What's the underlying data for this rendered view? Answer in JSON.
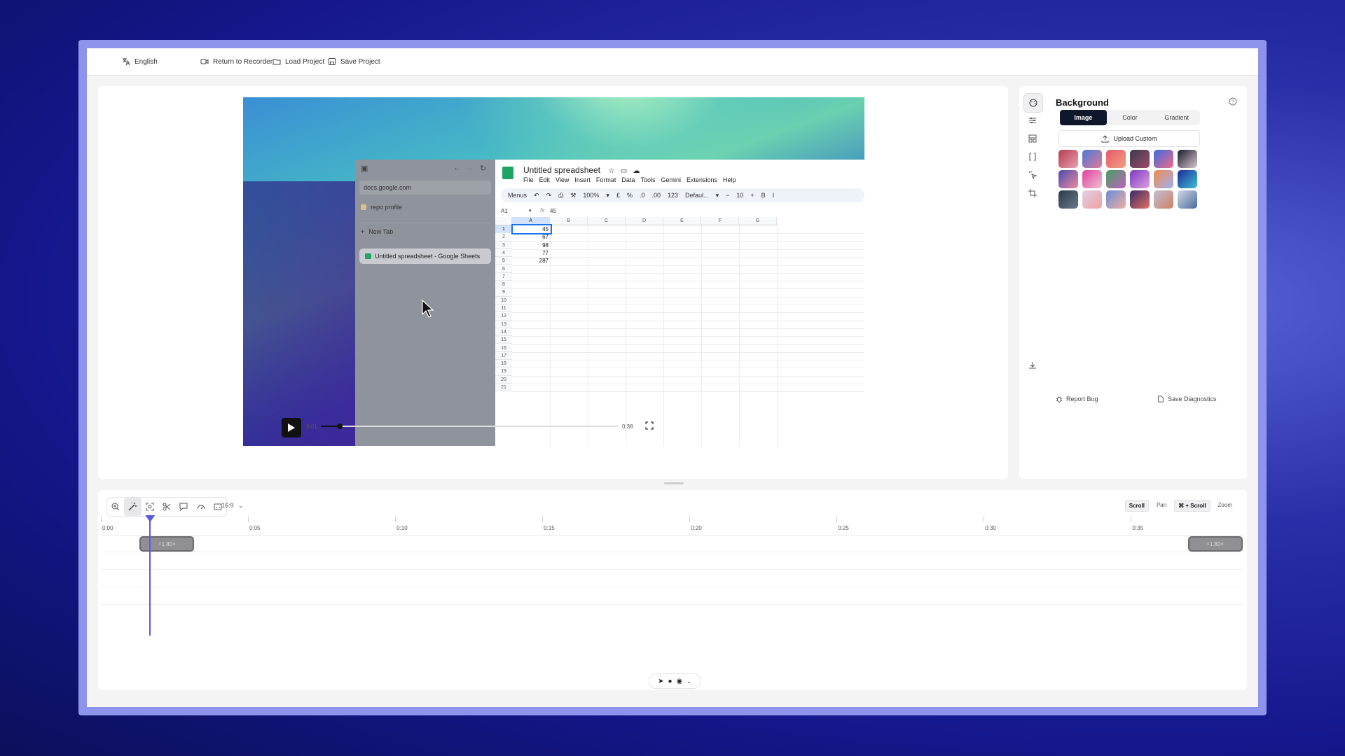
{
  "topbar": {
    "language": "English",
    "return_label": "Return to Recorder",
    "load_label": "Load Project",
    "save_label": "Save Project"
  },
  "preview": {
    "browser": {
      "url": "docs.google.com",
      "bookmark": "repo profile",
      "new_tab": "New Tab",
      "active_tab": "Untitled spreadsheet - Google Sheets"
    },
    "sheet": {
      "title": "Untitled spreadsheet",
      "menu": [
        "File",
        "Edit",
        "View",
        "Insert",
        "Format",
        "Data",
        "Tools",
        "Gemini",
        "Extensions",
        "Help"
      ],
      "toolbar": [
        "Menus",
        "↶",
        "↷",
        "⎙",
        "⚒",
        "100%",
        "▾",
        "£",
        "%",
        ".0",
        ".00",
        "123",
        "Defaul...",
        "▾",
        "−",
        "10",
        "+",
        "B",
        "I"
      ],
      "cell_ref": "A1",
      "formula": "45",
      "columns": [
        "A",
        "B",
        "C",
        "D",
        "E",
        "F",
        "G"
      ],
      "rows": [
        "1",
        "2",
        "3",
        "4",
        "5",
        "6",
        "7",
        "8",
        "9",
        "10",
        "11",
        "12",
        "13",
        "14",
        "15",
        "16",
        "17",
        "18",
        "19",
        "20",
        "21"
      ],
      "col_a_values": [
        "45",
        "67",
        "98",
        "77",
        "287"
      ]
    },
    "time_current": "0:01",
    "time_total": "0:38",
    "progress": 0.026
  },
  "right_panel": {
    "title": "Background",
    "tabs": [
      "Image",
      "Color",
      "Gradient"
    ],
    "active_tab": "Image",
    "upload_label": "Upload Custom",
    "report_bug": "Report Bug",
    "save_diagnostics": "Save Diagnostics",
    "thumb_colors": [
      [
        "#b43c4e",
        "#e8a0b0"
      ],
      [
        "#4a7ad8",
        "#e07a9a"
      ],
      [
        "#e65a6a",
        "#f0a080"
      ],
      [
        "#3a3a50",
        "#a04a6a"
      ],
      [
        "#3a6ae0",
        "#f06a8a"
      ],
      [
        "#1a1a2a",
        "#d8c8d0"
      ],
      [
        "#4a4ab0",
        "#f08aa0"
      ],
      [
        "#e040a0",
        "#f0c0d0"
      ],
      [
        "#4aa060",
        "#c060c0"
      ],
      [
        "#7a3ac0",
        "#e0a0e0"
      ],
      [
        "#f08a50",
        "#a0b0f0"
      ],
      [
        "#1a2a9a",
        "#40c0d0"
      ],
      [
        "#2a3a4a",
        "#6a7a8a"
      ],
      [
        "#e0d0e8",
        "#f0a0a0"
      ],
      [
        "#6a8ad8",
        "#f0b0a0"
      ],
      [
        "#3a2a6a",
        "#e07060"
      ],
      [
        "#c0c0d8",
        "#d08060"
      ],
      [
        "#d0dae8",
        "#4a6a9a"
      ]
    ]
  },
  "timeline": {
    "aspect": "16:9",
    "modes": [
      "Scroll",
      "Pan",
      "⌘ + Scroll",
      "Zoom"
    ],
    "active_mode": "Scroll",
    "ticks": [
      "0:00",
      "0:05",
      "0:10",
      "0:15",
      "0:20",
      "0:25",
      "0:30",
      "0:35"
    ],
    "zoom_clips": [
      "1.80×",
      "1.80×"
    ],
    "duration_seconds": 38.8,
    "playhead_seconds": 1.65
  }
}
